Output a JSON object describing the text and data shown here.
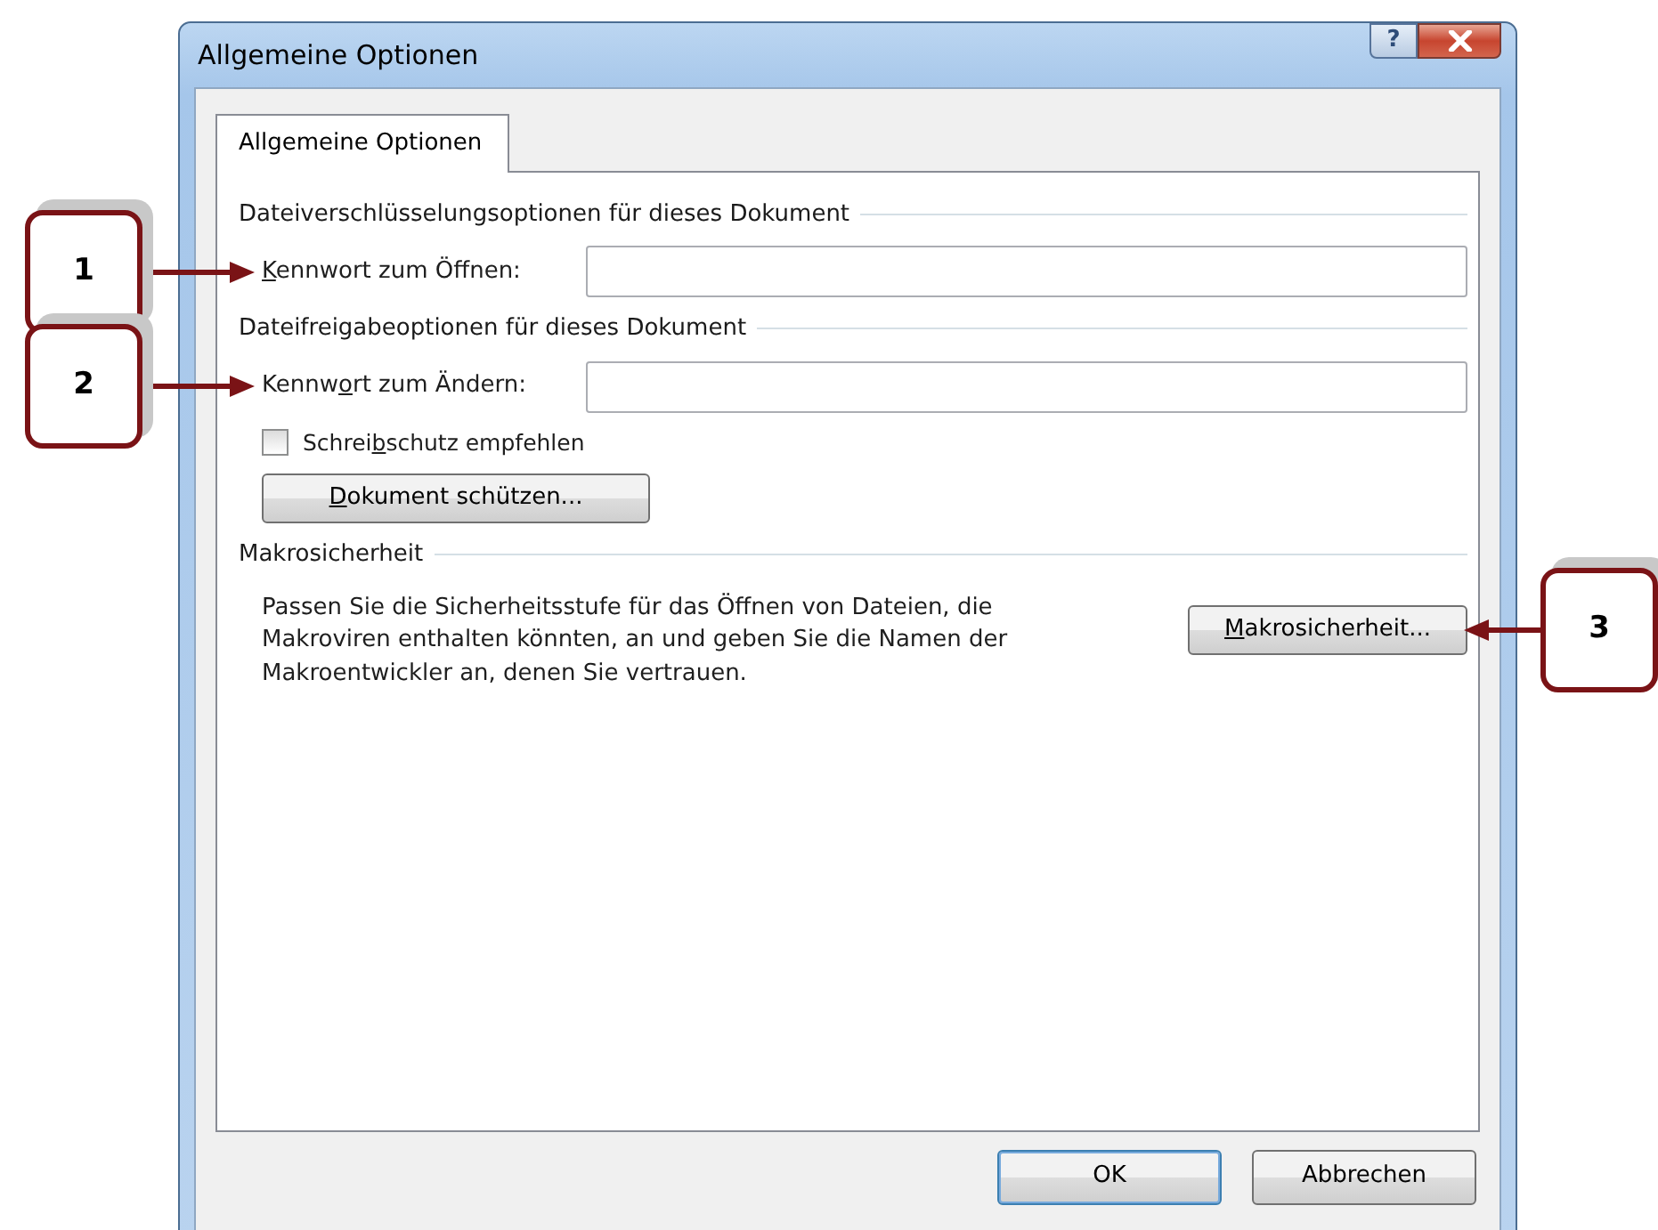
{
  "window": {
    "title": "Allgemeine Optionen",
    "help_button": "?"
  },
  "tabs": [
    {
      "label": "Allgemeine Optionen",
      "selected": true
    }
  ],
  "sections": [
    {
      "heading": "Dateiverschlüsselungsoptionen für dieses Dokument",
      "controls": [
        {
          "kind": "password",
          "label": {
            "key": "K",
            "post": "ennwort zum Öffnen:"
          },
          "callout": "1"
        }
      ]
    },
    {
      "heading": "Dateifreigabeoptionen für dieses Dokument",
      "controls": [
        {
          "kind": "password",
          "label": {
            "pre": "Kennw",
            "key": "o",
            "post": "rt zum Ändern:"
          },
          "callout": "2"
        },
        {
          "kind": "checkbox",
          "label": {
            "pre": "Schrei",
            "key": "b",
            "post": "schutz empfehlen"
          },
          "checked": false
        },
        {
          "kind": "button",
          "label": {
            "key": "D",
            "post": "okument schützen..."
          }
        }
      ]
    },
    {
      "heading": "Makrosicherheit",
      "controls": [
        {
          "kind": "description",
          "text": "Passen Sie die Sicherheitsstufe für das Öffnen von Dateien, die Makroviren enthalten könnten, an und geben Sie die Namen der Makroentwickler an, denen Sie vertrauen.",
          "button": {
            "key": "M",
            "post": "akrosicherheit..."
          },
          "callout": "3"
        }
      ]
    }
  ],
  "buttons": [
    {
      "label": "OK",
      "default": true
    },
    {
      "label": "Abbrechen",
      "default": false
    }
  ]
}
